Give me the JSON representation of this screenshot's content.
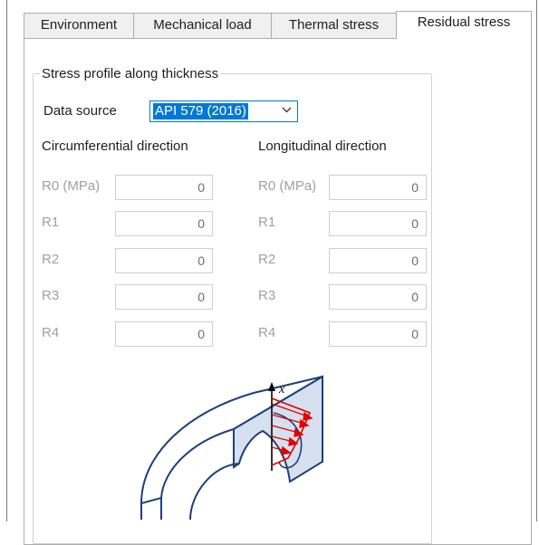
{
  "tabs": [
    "Environment",
    "Mechanical load",
    "Thermal stress",
    "Residual stress"
  ],
  "group": {
    "title": "Stress profile along thickness",
    "data_source_label": "Data source",
    "data_source_value": "API 579 (2016)"
  },
  "circumferential": {
    "header": "Circumferential direction",
    "rows": [
      {
        "label": "R0 (MPa)",
        "value": "0"
      },
      {
        "label": "R1",
        "value": "0"
      },
      {
        "label": "R2",
        "value": "0"
      },
      {
        "label": "R3",
        "value": "0"
      },
      {
        "label": "R4",
        "value": "0"
      }
    ]
  },
  "longitudinal": {
    "header": "Longitudinal direction",
    "rows": [
      {
        "label": "R0 (MPa)",
        "value": "0"
      },
      {
        "label": "R1",
        "value": "0"
      },
      {
        "label": "R2",
        "value": "0"
      },
      {
        "label": "R3",
        "value": "0"
      },
      {
        "label": "R4",
        "value": "0"
      }
    ]
  },
  "diagram": {
    "axis_label": "x"
  },
  "colors": {
    "accent": "#0078d7",
    "outline": "#1f3f7a",
    "face": "#d6e0ef",
    "arrow": "#e00000"
  }
}
